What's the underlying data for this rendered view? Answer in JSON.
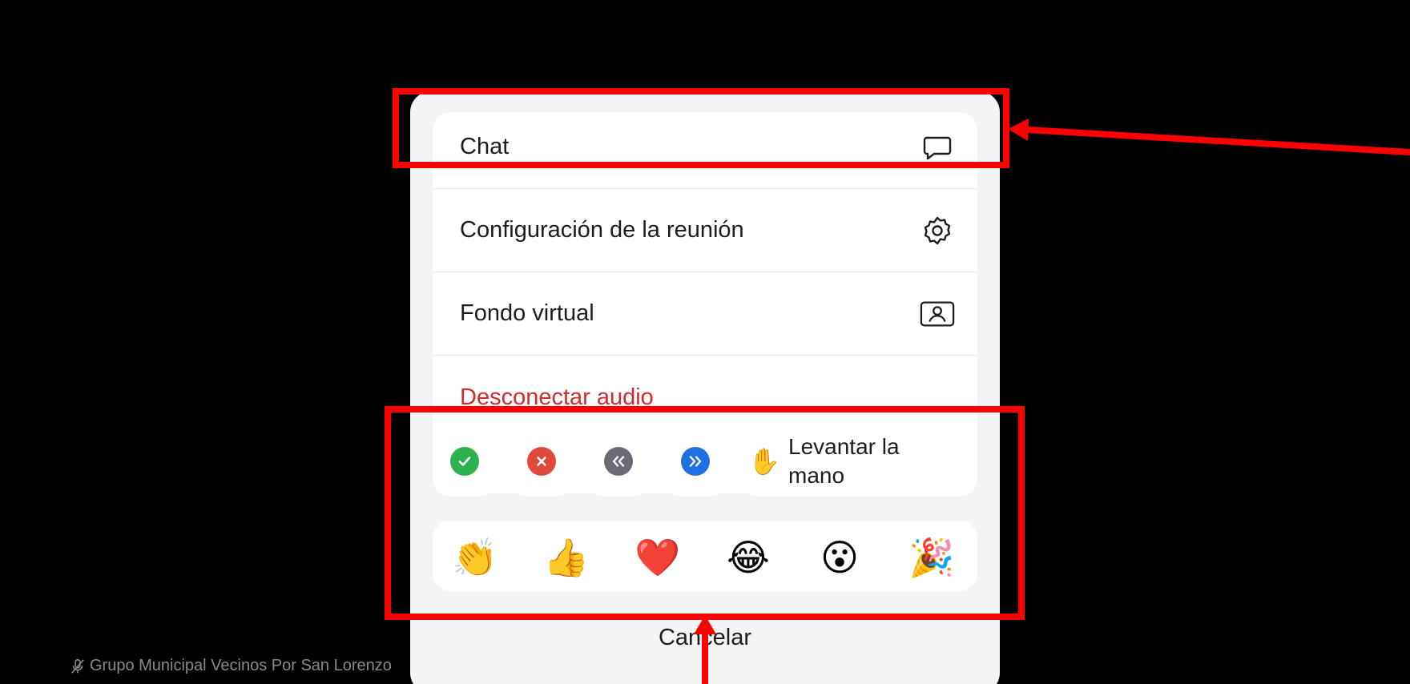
{
  "participant": {
    "name": "Grupo Municipal Vecinos Por San Lorenzo",
    "icon": "muted-mic-icon"
  },
  "menu": {
    "items": [
      {
        "label": "Chat",
        "icon": "chat-bubble-icon"
      },
      {
        "label": "Configuración de la reunión",
        "icon": "gear-icon"
      },
      {
        "label": "Fondo virtual",
        "icon": "virtual-background-icon"
      },
      {
        "label": "Desconectar audio",
        "color": "#d12b2b"
      }
    ]
  },
  "quick_actions": {
    "items": [
      {
        "icon": "check-icon",
        "color": "#2bb24c"
      },
      {
        "icon": "cross-icon",
        "color": "#e0483c"
      },
      {
        "icon": "slower-icon",
        "color": "#6b6b76"
      },
      {
        "icon": "faster-icon",
        "color": "#1f6fe5"
      }
    ],
    "raise_hand": {
      "label": "Levantar la mano",
      "icon": "raised-hand-icon",
      "glyph": "✋"
    }
  },
  "reactions": [
    {
      "name": "clapping-hands",
      "glyph": "👏"
    },
    {
      "name": "thumbs-up",
      "glyph": "👍"
    },
    {
      "name": "red-heart",
      "glyph": "❤️"
    },
    {
      "name": "tears-of-joy",
      "glyph": "😂"
    },
    {
      "name": "surprised-face",
      "glyph": "😮"
    },
    {
      "name": "party-popper",
      "glyph": "🎉"
    }
  ],
  "cancel_label": "Cancelar",
  "annotation_color": "#ff0000"
}
